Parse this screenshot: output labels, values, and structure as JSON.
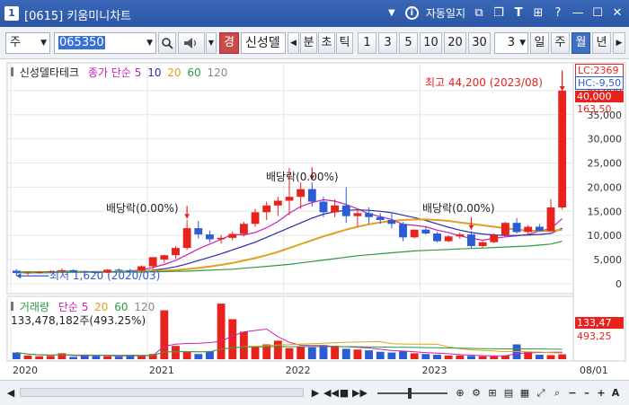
{
  "window": {
    "number_badge": "1",
    "title": "[0615] 키움미니차트",
    "auto_lock_label": "자동일지"
  },
  "toolbar": {
    "market_select": "주",
    "code_value": "065350",
    "stock_name": "신성델",
    "badge_warning": "경",
    "period_buttons": [
      "분",
      "초",
      "틱"
    ],
    "interval_buttons": [
      "1",
      "3",
      "5",
      "10",
      "20",
      "30"
    ],
    "interval_select": "3",
    "unit_buttons": [
      "일",
      "주",
      "월",
      "년"
    ],
    "active_unit": "월"
  },
  "price_legend": {
    "name": "신성델타테크",
    "series_label": "종가 단순",
    "ma": [
      "5",
      "10",
      "20",
      "60",
      "120"
    ]
  },
  "volume_legend": {
    "name": "거래량",
    "series_label": "단순",
    "ma": [
      "5",
      "20",
      "60",
      "120"
    ],
    "value": "133,478,182주(493.25%)"
  },
  "right_labels": {
    "lc": "LC:2369",
    "hc": "HC:-9,50",
    "current_price": "40,000",
    "change": "163,50",
    "vol_current": "133,47",
    "vol_pct": "493,25"
  },
  "annotations": {
    "high": "최고 44,200 (2023/08)",
    "low": "최저 1,620 (2020/03)",
    "dividend_1": "배당락(0.00%)",
    "dividend_2": "배당락(0.00%)",
    "dividend_3": "배당락(0.00%)"
  },
  "chart_data": {
    "type": "candlestick",
    "x_ticks": [
      "2020",
      "2021",
      "2022",
      "2023"
    ],
    "y_ticks": [
      0,
      5000,
      10000,
      15000,
      20000,
      25000,
      30000,
      35000,
      40000
    ],
    "ylim": [
      -1500,
      45000
    ],
    "candles": [
      [
        2700,
        3000,
        1620,
        2200
      ],
      [
        2200,
        2500,
        1800,
        2300
      ],
      [
        2300,
        2600,
        2100,
        2400
      ],
      [
        2400,
        2800,
        2200,
        2600
      ],
      [
        2600,
        3200,
        2400,
        2800
      ],
      [
        2800,
        3000,
        2300,
        2500
      ],
      [
        2500,
        2700,
        2200,
        2400
      ],
      [
        2400,
        2600,
        2100,
        2300
      ],
      [
        2300,
        3000,
        2200,
        2900
      ],
      [
        2900,
        3200,
        2600,
        2800
      ],
      [
        2800,
        3100,
        2500,
        2700
      ],
      [
        2700,
        3800,
        2600,
        3600
      ],
      [
        3600,
        4800,
        2900,
        5500
      ],
      [
        5000,
        6000,
        4300,
        5900
      ],
      [
        5900,
        7800,
        5200,
        7400
      ],
      [
        7400,
        13200,
        7000,
        11500
      ],
      [
        11500,
        13000,
        9400,
        10200
      ],
      [
        10200,
        11000,
        8600,
        9200
      ],
      [
        9200,
        10100,
        8300,
        9500
      ],
      [
        9500,
        10800,
        9000,
        10300
      ],
      [
        10300,
        12800,
        9800,
        12400
      ],
      [
        12400,
        15500,
        11800,
        14800
      ],
      [
        14800,
        17000,
        13200,
        16200
      ],
      [
        16200,
        18000,
        14000,
        17200
      ],
      [
        17200,
        24000,
        14200,
        18000
      ],
      [
        18000,
        21000,
        15500,
        19600
      ],
      [
        19600,
        21000,
        16000,
        17000
      ],
      [
        17000,
        18000,
        13800,
        14800
      ],
      [
        14800,
        17500,
        13800,
        16200
      ],
      [
        16200,
        20000,
        12600,
        14000
      ],
      [
        14000,
        15600,
        11800,
        14600
      ],
      [
        14600,
        15800,
        12400,
        13800
      ],
      [
        13800,
        14600,
        12400,
        13200
      ],
      [
        13200,
        14500,
        11500,
        12400
      ],
      [
        12400,
        12800,
        8800,
        9600
      ],
      [
        9600,
        11200,
        9400,
        11200
      ],
      [
        11200,
        11900,
        10200,
        10400
      ],
      [
        10400,
        10700,
        8600,
        8800
      ],
      [
        8800,
        10000,
        8600,
        9800
      ],
      [
        9800,
        10600,
        9300,
        10200
      ],
      [
        10200,
        10900,
        7400,
        7800
      ],
      [
        7800,
        8800,
        7500,
        8600
      ],
      [
        8600,
        10500,
        8400,
        10100
      ],
      [
        10100,
        12800,
        9800,
        12600
      ],
      [
        12600,
        13600,
        10400,
        10700
      ],
      [
        10700,
        12200,
        10200,
        11800
      ],
      [
        11800,
        12400,
        10800,
        10900
      ],
      [
        10900,
        17500,
        10700,
        15800
      ],
      [
        15800,
        44200,
        15400,
        40000
      ]
    ],
    "volume_max": 140000000,
    "volume": [
      18,
      10,
      8,
      9,
      16,
      6,
      11,
      9,
      8,
      7,
      12,
      10,
      14,
      132,
      36,
      20,
      14,
      22,
      150,
      108,
      74,
      34,
      40,
      50,
      30,
      34,
      32,
      38,
      36,
      28,
      26,
      24,
      20,
      18,
      22,
      16,
      14,
      12,
      10,
      10,
      9,
      8,
      8,
      10,
      40,
      20,
      12,
      11,
      13,
      133
    ],
    "ma": [
      {
        "label": "5",
        "color": "#c822b4",
        "values": [
          2400,
          2350,
          2300,
          2350,
          2500,
          2560,
          2520,
          2480,
          2460,
          2580,
          2640,
          2860,
          3380,
          3980,
          4840,
          6000,
          7200,
          8200,
          9200,
          10200,
          10100,
          10600,
          11600,
          12900,
          14600,
          16000,
          16800,
          17400,
          17100,
          16400,
          15500,
          14500,
          13900,
          13300,
          12300,
          12100,
          11800,
          11100,
          10600,
          9900,
          9400,
          9000,
          9400,
          9700,
          9900,
          10200,
          10900,
          11400,
          13500
        ]
      },
      {
        "label": "10",
        "color": "#2c2ca8",
        "values": [
          2300,
          2300,
          2300,
          2300,
          2350,
          2400,
          2420,
          2440,
          2460,
          2500,
          2550,
          2620,
          2800,
          3100,
          3500,
          4100,
          4800,
          5500,
          6200,
          7000,
          7800,
          8600,
          9600,
          10600,
          11600,
          12600,
          13600,
          14400,
          14900,
          15200,
          15300,
          15200,
          15000,
          14700,
          14200,
          13700,
          13100,
          12400,
          11700,
          11100,
          10600,
          10300,
          10100,
          10000,
          10000,
          10100,
          10200,
          10400,
          11500
        ]
      },
      {
        "label": "20",
        "color": "#e0a020",
        "values": [
          2400,
          2400,
          2400,
          2400,
          2400,
          2420,
          2440,
          2460,
          2480,
          2500,
          2520,
          2560,
          2620,
          2700,
          2840,
          3000,
          3260,
          3560,
          3900,
          4300,
          4800,
          5300,
          5900,
          6600,
          7400,
          8200,
          9000,
          9800,
          10500,
          11200,
          11800,
          12300,
          12700,
          13000,
          13200,
          13300,
          13300,
          13200,
          13000,
          12700,
          12400,
          12100,
          11800,
          11500,
          11200,
          11000,
          10900,
          10900,
          11200
        ]
      },
      {
        "label": "60",
        "color": "#2c9a44",
        "values": [
          2400,
          2400,
          2400,
          2400,
          2400,
          2400,
          2400,
          2400,
          2400,
          2400,
          2400,
          2400,
          2450,
          2500,
          2550,
          2600,
          2700,
          2800,
          2900,
          3000,
          3200,
          3400,
          3600,
          3800,
          4000,
          4300,
          4600,
          4900,
          5200,
          5500,
          5800,
          6000,
          6200,
          6400,
          6600,
          6800,
          6900,
          7000,
          7100,
          7200,
          7300,
          7400,
          7500,
          7600,
          7700,
          7800,
          8000,
          8200,
          8800
        ]
      },
      {
        "label": "120",
        "color": "#888888",
        "values": []
      }
    ]
  },
  "colors": {
    "up": "#e8231e",
    "down": "#2c5bd6",
    "title_bar": "#2b56a6",
    "grid": "#e6e6e6"
  }
}
